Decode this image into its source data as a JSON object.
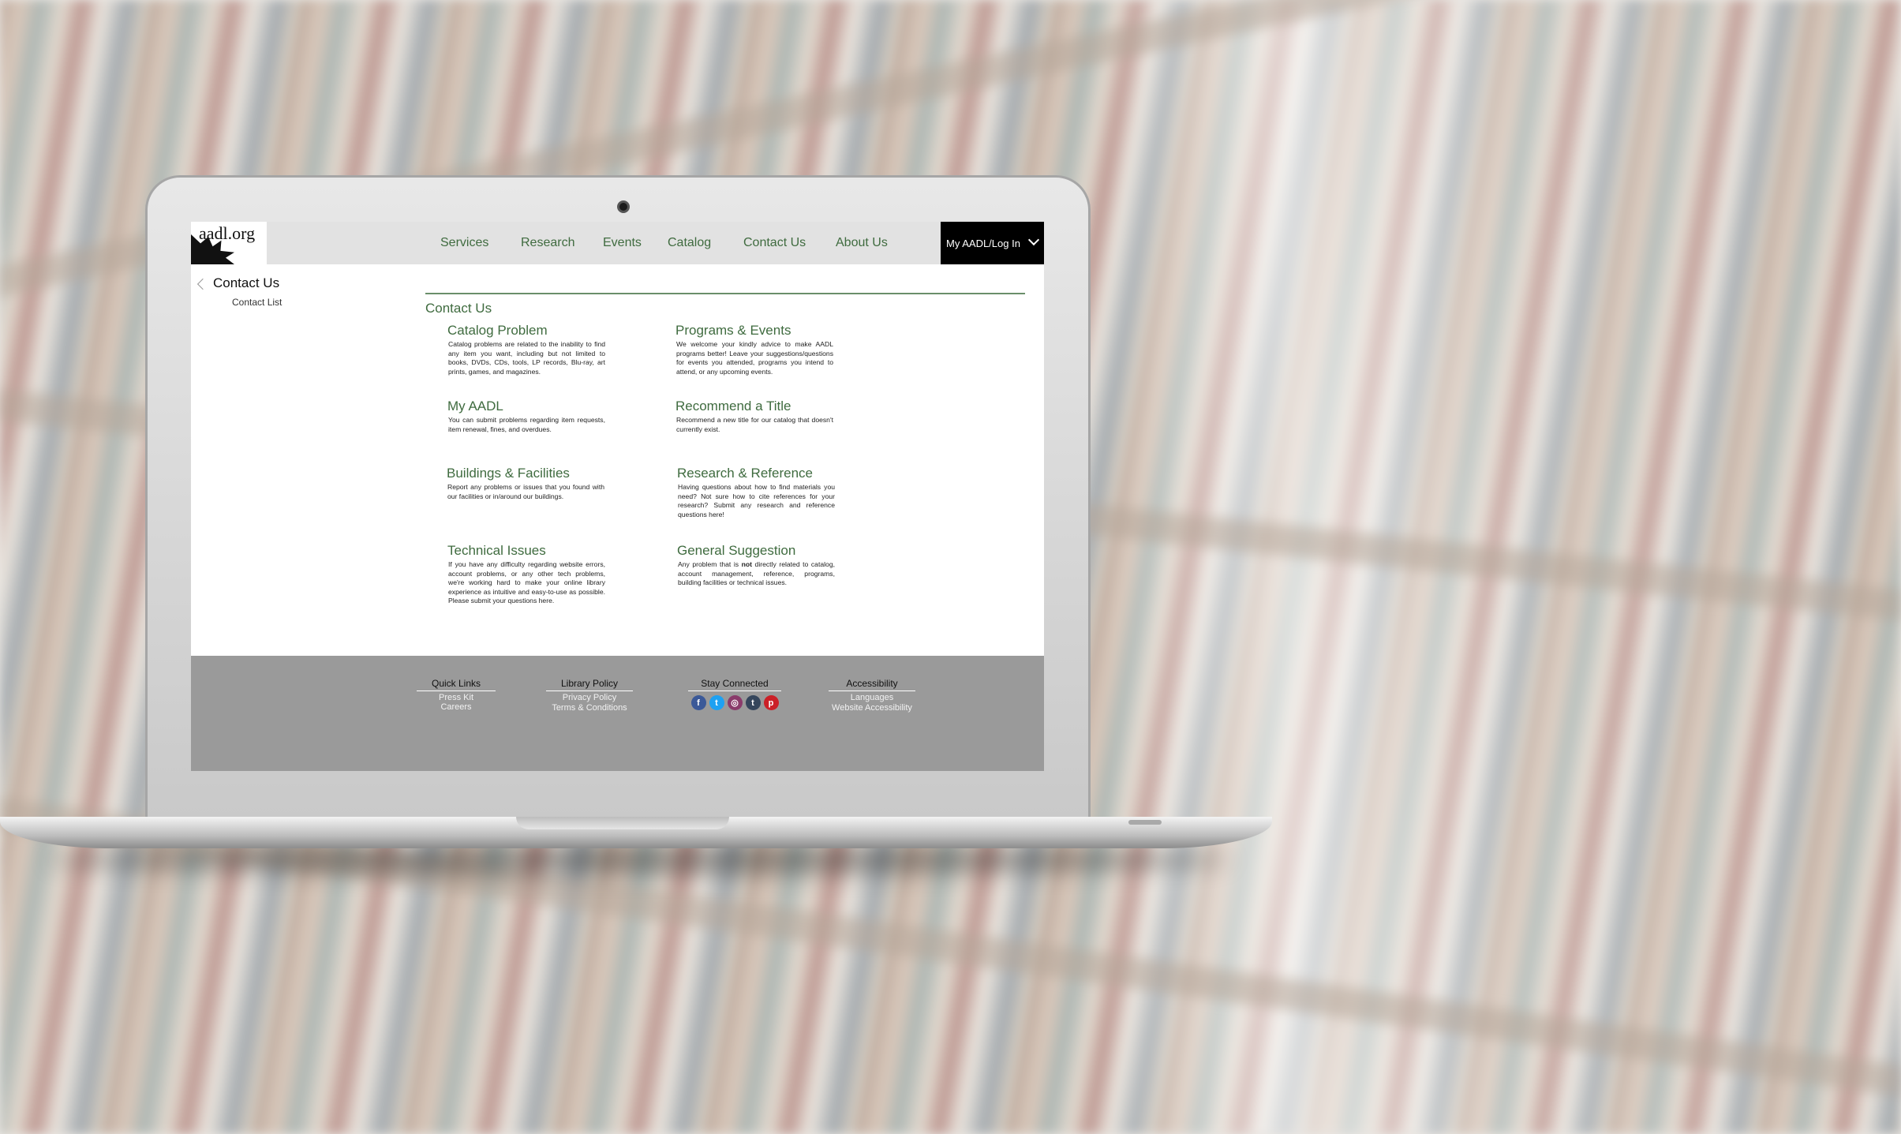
{
  "site": {
    "logo_text": "aadl.org"
  },
  "nav": {
    "items": [
      "Services",
      "Research",
      "Events",
      "Catalog",
      "Contact Us",
      "About Us"
    ],
    "login_label": "My AADL/Log In"
  },
  "sidebar": {
    "title": "Contact Us",
    "sub_item": "Contact List"
  },
  "main": {
    "title": "Contact Us",
    "cards": [
      {
        "title": "Catalog Problem",
        "text": "Catalog problems are related to the inability to find any item you want, including but not limited to books, DVDs, CDs, tools, LP records, Blu-ray, art prints, games, and magazines."
      },
      {
        "title": "Programs & Events",
        "text": "We welcome your kindly advice to make AADL programs better! Leave your suggestions/questions for events you attended, programs you intend to attend, or any upcoming events."
      },
      {
        "title": "My AADL",
        "text": "You can submit problems regarding item requests, item renewal, fines, and overdues."
      },
      {
        "title": "Recommend a Title",
        "text": "Recommend a new title for our catalog that doesn't currently exist."
      },
      {
        "title": "Buildings & Facilities",
        "text": "Report any problems or issues that you found with our facilities or in/around our buildings."
      },
      {
        "title": "Research & Reference",
        "text": "Having questions about how to find materials you need? Not sure how to cite references for your research? Submit any research and reference questions here!"
      },
      {
        "title": "Technical Issues",
        "text": "If you have any difficulty regarding website errors, account problems, or any other tech problems, we're working hard to make your online library experience as intuitive and easy-to-use as possible. Please submit your questions here."
      },
      {
        "title": "General Suggestion",
        "text_before": "Any problem that is ",
        "text_bold": "not",
        "text_after": " directly related to catalog, account management, reference, programs, building facilities or technical issues."
      }
    ]
  },
  "footer": {
    "quick_links": {
      "heading": "Quick Links",
      "links": [
        "Press Kit",
        "Careers"
      ]
    },
    "library_policy": {
      "heading": "Library Policy",
      "links": [
        "Privacy Policy",
        "Terms & Conditions"
      ]
    },
    "stay_connected": {
      "heading": "Stay Connected",
      "social": [
        {
          "icon": "facebook-icon",
          "glyph": "f",
          "color": "#3b5998"
        },
        {
          "icon": "twitter-icon",
          "glyph": "t",
          "color": "#1da1f2"
        },
        {
          "icon": "instagram-icon",
          "glyph": "◎",
          "color": "#8a3b6b"
        },
        {
          "icon": "tumblr-icon",
          "glyph": "t",
          "color": "#35465c"
        },
        {
          "icon": "pinterest-icon",
          "glyph": "p",
          "color": "#cb2027"
        }
      ]
    },
    "accessibility": {
      "heading": "Accessibility",
      "links": [
        "Languages",
        "Website Accessibility"
      ]
    }
  }
}
